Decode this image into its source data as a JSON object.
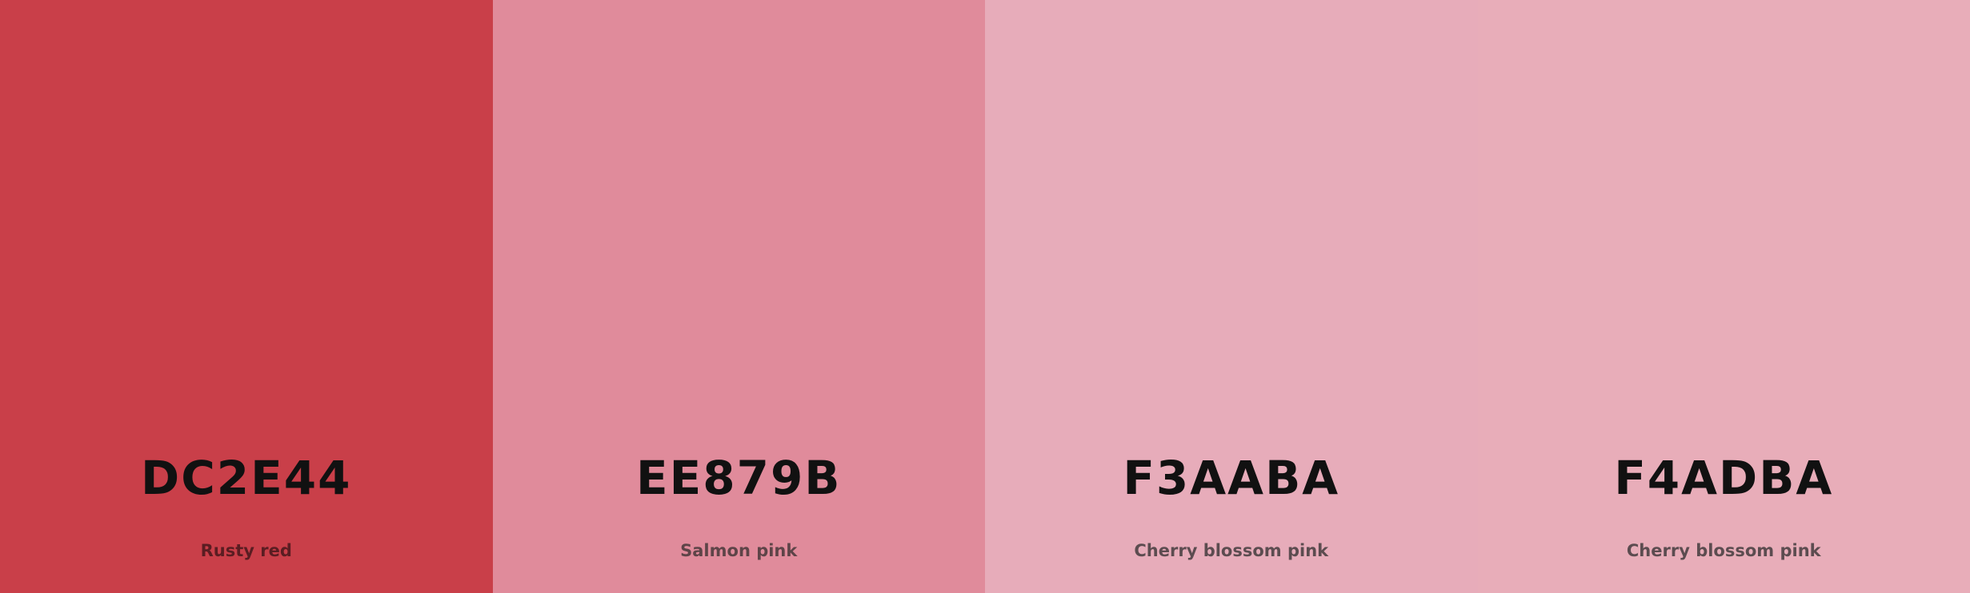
{
  "swatches": [
    {
      "hex": "DC2E44",
      "name": "Rusty red",
      "color": "#C93F49",
      "name_color": "#5a1d22"
    },
    {
      "hex": "EE879B",
      "name": "Salmon pink",
      "color": "#E08B9B",
      "name_color": "#5e4448"
    },
    {
      "hex": "F3AABA",
      "name": "Cherry blossom pink",
      "color": "#E7ACBA",
      "name_color": "#5c4c50"
    },
    {
      "hex": "F4ADBA",
      "name": "Cherry blossom pink",
      "color": "#E8ADB9",
      "name_color": "#5c4c50"
    }
  ]
}
